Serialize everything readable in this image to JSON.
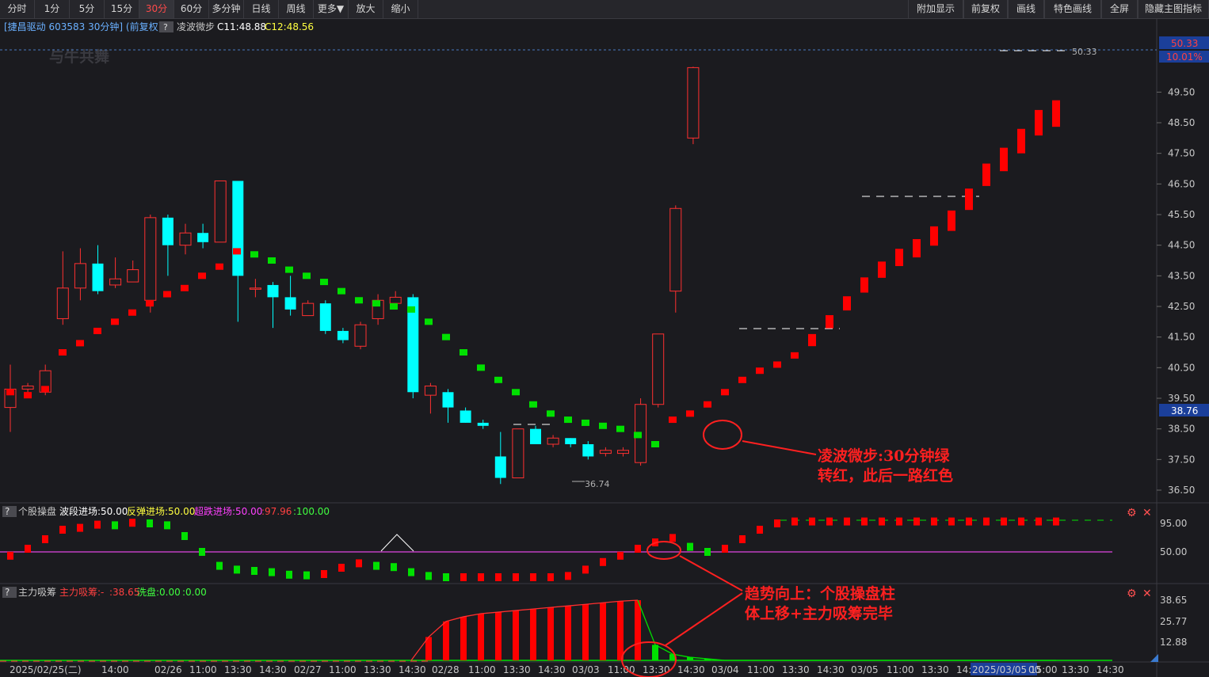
{
  "toolbar": {
    "left_buttons": [
      "分时",
      "1分",
      "5分",
      "15分",
      "30分",
      "60分",
      "多分钟",
      "日线",
      "周线",
      "更多▼",
      "放大",
      "缩小"
    ],
    "active_index": 4,
    "right_buttons": [
      "附加显示",
      "前复权",
      "画线",
      "特色画线",
      "全屏",
      "隐藏主图指标"
    ]
  },
  "main_header": {
    "stock": "[捷昌驱动 603583 30分钟] (前复权)",
    "help": "?",
    "indicator": "凌波微步",
    "c1": "C11:48.88",
    "c2": "C12:48.56"
  },
  "watermark": "与牛共舞",
  "price_axis": {
    "ticks": [
      "49.50",
      "48.50",
      "47.50",
      "46.50",
      "45.50",
      "44.50",
      "43.50",
      "42.50",
      "41.50",
      "40.50",
      "39.50",
      "38.50",
      "37.50",
      "36.50"
    ],
    "high_label": "50.33",
    "high_pct": "10.01%",
    "current": "38.76",
    "top_line_label": "50.33",
    "low_label": "36.74"
  },
  "sub1": {
    "help": "?",
    "name": "个股操盘",
    "p1": "波段进场:50.00",
    "p2": "反弹进场:50.00",
    "p3": "超跌进场:50.00",
    "p4": ":97.96",
    "p5": ":100.00",
    "axis": [
      "95.00",
      "50.00"
    ]
  },
  "sub2": {
    "help": "?",
    "name": "主力吸筹",
    "p1": "主力吸筹:-",
    "p2": ":38.65",
    "p3": "洗盘:0.00",
    "p4": ":0.00",
    "axis": [
      "38.65",
      "25.77",
      "12.88"
    ]
  },
  "x_axis": [
    "2025/02/25(二)",
    "14:00",
    "02/26",
    "11:00",
    "13:30",
    "14:30",
    "02/27",
    "11:00",
    "13:30",
    "14:30",
    "02/28",
    "11:00",
    "13:30",
    "14:30",
    "03/03",
    "11:00",
    "13:30",
    "14:30",
    "03/04",
    "11:00",
    "13:30",
    "14:30",
    "03/05",
    "11:00",
    "13:30",
    "14:30",
    "2025/03/05 15:00",
    "00",
    "13:30",
    "14:30"
  ],
  "annotations": {
    "a1_line1": "凌波微步:30分钟绿",
    "a1_line2": "转红，此后一路红色",
    "a2_line1": "趋势向上：个股操盘柱",
    "a2_line2": "体上移+主力吸筹完毕"
  },
  "colors": {
    "up": "#ff3030",
    "down": "#00ffff",
    "red_marker": "#ff0000",
    "green_marker": "#00e000",
    "annotation": "#ff2020",
    "accent_active": "#ff4a4a"
  },
  "chart_data": {
    "type": "candlestick",
    "interval": "30分钟",
    "candles": [
      [
        39.2,
        39.8,
        38.4,
        40.6
      ],
      [
        39.8,
        39.9,
        39.6,
        40.0
      ],
      [
        39.7,
        40.4,
        39.6,
        40.6
      ],
      [
        42.1,
        43.1,
        41.9,
        44.3
      ],
      [
        43.1,
        43.9,
        42.7,
        44.4
      ],
      [
        43.9,
        43.0,
        42.9,
        44.5
      ],
      [
        43.2,
        43.4,
        43.1,
        44.1
      ],
      [
        43.3,
        43.7,
        43.3,
        44.0
      ],
      [
        42.7,
        45.4,
        42.3,
        45.5
      ],
      [
        45.4,
        44.5,
        43.5,
        45.5
      ],
      [
        44.5,
        44.9,
        44.2,
        45.2
      ],
      [
        44.9,
        44.6,
        44.4,
        45.2
      ],
      [
        44.6,
        46.6,
        44.6,
        46.6
      ],
      [
        46.6,
        43.5,
        42.0,
        46.6
      ],
      [
        43.1,
        43.1,
        42.8,
        43.4
      ],
      [
        43.2,
        42.8,
        41.8,
        43.3
      ],
      [
        42.8,
        42.4,
        42.2,
        43.5
      ],
      [
        42.2,
        42.6,
        42.2,
        42.7
      ],
      [
        42.6,
        41.7,
        41.6,
        42.7
      ],
      [
        41.7,
        41.4,
        41.3,
        41.8
      ],
      [
        41.2,
        41.9,
        41.1,
        42.0
      ],
      [
        42.1,
        42.7,
        41.9,
        42.9
      ],
      [
        42.6,
        42.8,
        42.5,
        43.0
      ],
      [
        42.8,
        39.7,
        39.5,
        42.9
      ],
      [
        39.6,
        39.9,
        39.0,
        40.0
      ],
      [
        39.7,
        39.2,
        38.7,
        39.8
      ],
      [
        39.1,
        38.7,
        38.7,
        39.2
      ],
      [
        38.7,
        38.6,
        38.5,
        38.8
      ],
      [
        37.6,
        36.9,
        36.7,
        38.4
      ],
      [
        36.9,
        38.5,
        36.9,
        38.5
      ],
      [
        38.5,
        38.0,
        38.0,
        38.6
      ],
      [
        38.0,
        38.2,
        37.9,
        38.3
      ],
      [
        38.2,
        38.0,
        37.9,
        38.2
      ],
      [
        38.0,
        37.6,
        37.5,
        38.1
      ],
      [
        37.7,
        37.8,
        37.6,
        37.9
      ],
      [
        37.7,
        37.8,
        37.6,
        37.9
      ],
      [
        37.4,
        39.3,
        37.3,
        39.5
      ],
      [
        39.3,
        41.6,
        39.2,
        41.6
      ],
      [
        43.0,
        45.7,
        42.3,
        45.8
      ],
      [
        48.0,
        50.3,
        47.8,
        50.33
      ]
    ],
    "lingbo_markers": [
      [
        39.7,
        "r"
      ],
      [
        39.6,
        "r"
      ],
      [
        39.8,
        "r"
      ],
      [
        41.0,
        "r"
      ],
      [
        41.3,
        "r"
      ],
      [
        41.7,
        "r"
      ],
      [
        42.0,
        "r"
      ],
      [
        42.3,
        "r"
      ],
      [
        42.6,
        "r"
      ],
      [
        42.9,
        "r"
      ],
      [
        43.1,
        "r"
      ],
      [
        43.5,
        "r"
      ],
      [
        43.8,
        "r"
      ],
      [
        44.3,
        "r"
      ],
      [
        44.2,
        "g"
      ],
      [
        44.0,
        "g"
      ],
      [
        43.7,
        "g"
      ],
      [
        43.5,
        "g"
      ],
      [
        43.3,
        "g"
      ],
      [
        43.0,
        "g"
      ],
      [
        42.7,
        "g"
      ],
      [
        42.6,
        "g"
      ],
      [
        42.5,
        "g"
      ],
      [
        42.4,
        "g"
      ],
      [
        42.0,
        "g"
      ],
      [
        41.5,
        "g"
      ],
      [
        41.0,
        "g"
      ],
      [
        40.5,
        "g"
      ],
      [
        40.1,
        "g"
      ],
      [
        39.7,
        "g"
      ],
      [
        39.3,
        "g"
      ],
      [
        39.0,
        "g"
      ],
      [
        38.8,
        "g"
      ],
      [
        38.7,
        "g"
      ],
      [
        38.6,
        "g"
      ],
      [
        38.5,
        "g"
      ],
      [
        38.3,
        "g"
      ],
      [
        38.0,
        "g"
      ],
      [
        38.8,
        "r"
      ],
      [
        39.0,
        "r"
      ],
      [
        39.3,
        "r"
      ],
      [
        39.7,
        "r"
      ],
      [
        40.1,
        "r"
      ],
      [
        40.4,
        "r"
      ],
      [
        40.6,
        "r"
      ],
      [
        40.9,
        "r"
      ],
      [
        41.4,
        "r"
      ],
      [
        42.0,
        "r"
      ],
      [
        42.6,
        "r"
      ],
      [
        43.2,
        "r"
      ],
      [
        43.7,
        "r"
      ],
      [
        44.1,
        "r"
      ],
      [
        44.4,
        "r"
      ],
      [
        44.8,
        "r"
      ],
      [
        45.3,
        "r"
      ],
      [
        46.0,
        "r"
      ],
      [
        46.8,
        "r"
      ],
      [
        47.3,
        "r"
      ],
      [
        47.9,
        "r"
      ],
      [
        48.5,
        "r"
      ],
      [
        48.8,
        "r"
      ]
    ],
    "sub1_values": [
      44,
      55,
      70,
      85,
      88,
      93,
      92,
      96,
      95,
      92,
      75,
      50,
      28,
      22,
      20,
      18,
      14,
      13,
      15,
      25,
      32,
      28,
      26,
      18,
      12,
      10,
      10,
      10,
      10,
      10,
      10,
      10,
      12,
      22,
      34,
      44,
      55,
      65,
      72,
      58,
      50,
      55,
      70,
      85,
      95,
      98,
      98,
      98,
      98,
      98,
      98,
      98,
      98,
      98,
      98,
      98,
      98,
      98,
      98,
      98,
      98
    ],
    "sub2_values": [
      0,
      0,
      0,
      0,
      0,
      0,
      0,
      0,
      0,
      0,
      0,
      0,
      0,
      0,
      0,
      0,
      0,
      0,
      0,
      0,
      0,
      0,
      0,
      0,
      15,
      25,
      28,
      30,
      31,
      32,
      33,
      34,
      35,
      36,
      37,
      38,
      38.65,
      10,
      4,
      2,
      1,
      0,
      0,
      0,
      0,
      0,
      0,
      0,
      0,
      0,
      0,
      0,
      0,
      0,
      0,
      0,
      0,
      0,
      0,
      0,
      0
    ]
  }
}
